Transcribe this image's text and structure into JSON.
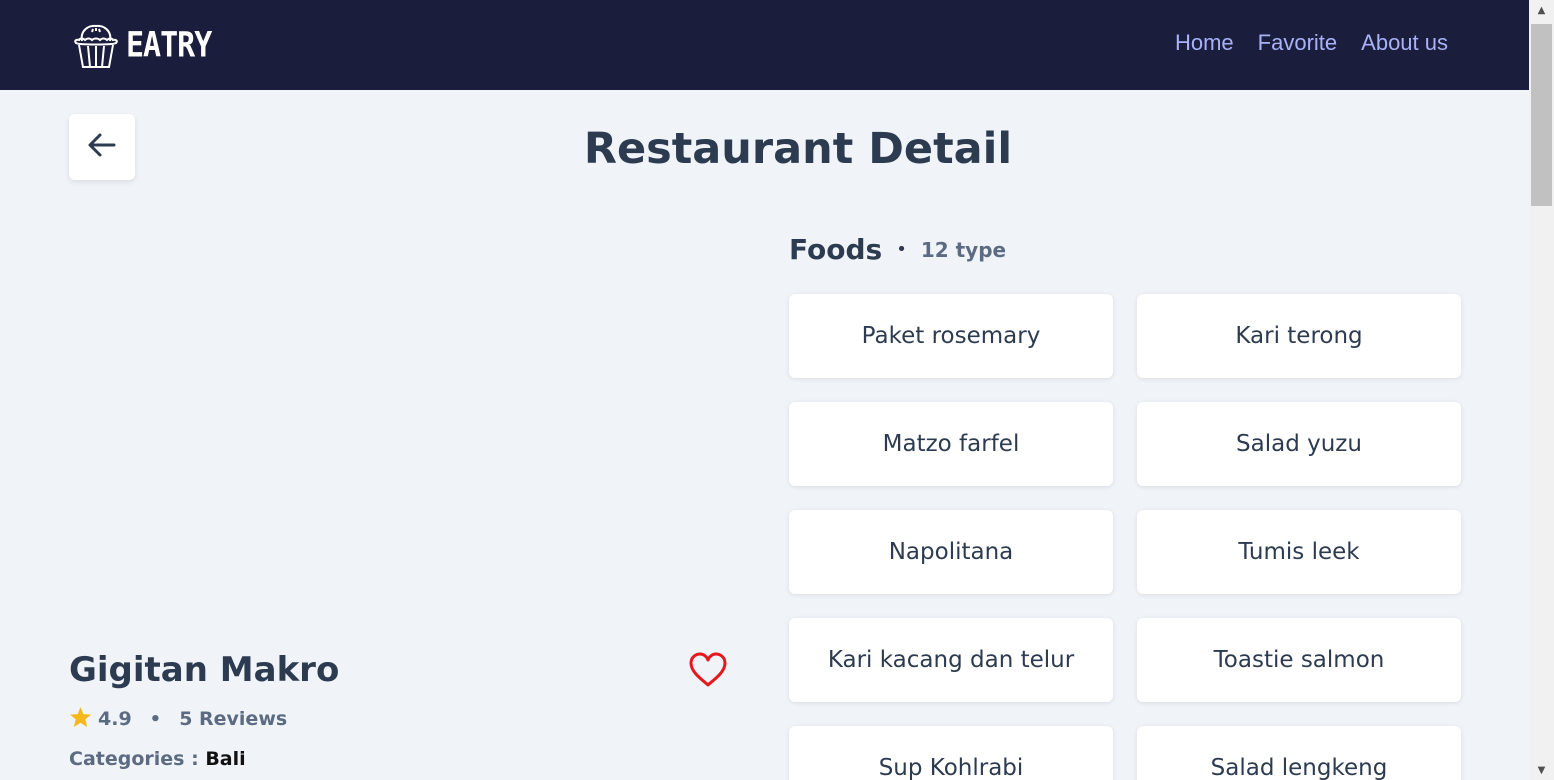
{
  "header": {
    "brand": "EATRY",
    "nav": [
      "Home",
      "Favorite",
      "About us"
    ]
  },
  "page": {
    "title": "Restaurant Detail"
  },
  "restaurant": {
    "name": "Gigitan Makro",
    "rating": "4.9",
    "reviews": "5 Reviews",
    "categories_label": "Categories :",
    "categories_value": "Bali"
  },
  "foods": {
    "title": "Foods",
    "count": "12 type",
    "items": [
      "Paket rosemary",
      "Kari terong",
      "Matzo farfel",
      "Salad yuzu",
      "Napolitana",
      "Tumis leek",
      "Kari kacang dan telur",
      "Toastie salmon",
      "Sup Kohlrabi",
      "Salad lengkeng"
    ]
  },
  "colors": {
    "navbar": "#1a1d3b",
    "nav_link": "#a9b2f7",
    "background": "#f0f4f9",
    "heart": "#e3191d",
    "star": "#f5b81c"
  },
  "icons": {
    "back": "arrow-left-icon",
    "favorite": "heart-icon",
    "rating": "star-icon",
    "logo": "muffin-icon"
  }
}
